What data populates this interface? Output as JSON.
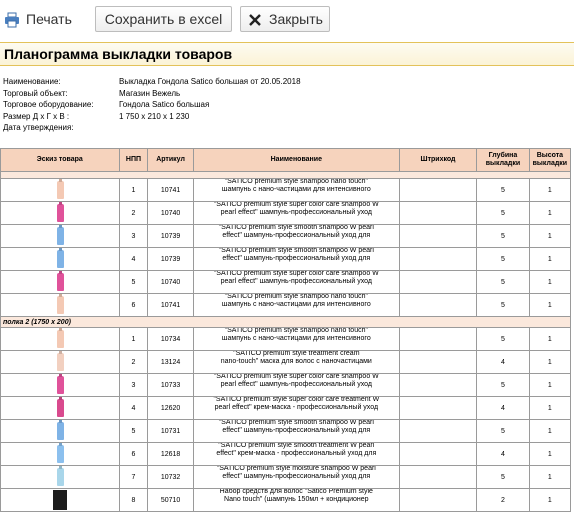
{
  "toolbar": {
    "print_label": "Печать",
    "excel_label": "Сохранить в excel",
    "close_label": "Закрыть"
  },
  "title": "Планограмма выкладки товаров",
  "meta": [
    {
      "label": "Наименование:",
      "value": "Выкладка Гондола Satico большая от 20.05.2018"
    },
    {
      "label": "Торговый объект:",
      "value": "Магазин Вежель"
    },
    {
      "label": "Торговое оборудование:",
      "value": "Гондола Satico большая"
    },
    {
      "label": "Размер Д х Г х В :",
      "value": "1 750 х 210 х 1 230"
    },
    {
      "label": "Дата утверждения:",
      "value": ""
    }
  ],
  "table": {
    "headers": [
      "Эскиз товара",
      "НПП",
      "Артикул",
      "Наименование",
      "Штрихкод",
      "Глубина выкладки",
      "Высота выкладки"
    ],
    "shelf2_label": "полка 2 (1750 х 200)",
    "shelf1_rows": [
      {
        "npp": "1",
        "art": "10741",
        "name1": "\"SATICO premium style shampoo nano touch\"",
        "name2": "шампунь с нано-частицами для интенсивного",
        "depth": "5",
        "height": "1",
        "color": "#f4c9b4"
      },
      {
        "npp": "2",
        "art": "10740",
        "name1": "\"SATICO premium style super color care shampoo W",
        "name2": "pearl effect\" шампунь-профессиональный уход",
        "depth": "5",
        "height": "1",
        "color": "#e0529a"
      },
      {
        "npp": "3",
        "art": "10739",
        "name1": "\"SATICO premium style smooth shampoo W pearl",
        "name2": "effect\" шампунь-профессиональный уход для",
        "depth": "5",
        "height": "1",
        "color": "#7fb3e6"
      },
      {
        "npp": "4",
        "art": "10739",
        "name1": "\"SATICO premium style smooth shampoo W pearl",
        "name2": "effect\" шампунь-профессиональный уход для",
        "depth": "5",
        "height": "1",
        "color": "#7fb3e6"
      },
      {
        "npp": "5",
        "art": "10740",
        "name1": "\"SATICO premium style super color care shampoo W",
        "name2": "pearl effect\" шампунь-профессиональный уход",
        "depth": "5",
        "height": "1",
        "color": "#e0529a"
      },
      {
        "npp": "6",
        "art": "10741",
        "name1": "\"SATICO premium style shampoo nano touch\"",
        "name2": "шампунь с нано-частицами для интенсивного",
        "depth": "5",
        "height": "1",
        "color": "#f4c9b4"
      }
    ],
    "shelf2_rows": [
      {
        "npp": "1",
        "art": "10734",
        "name1": "\"SATICO premium style shampoo nano touch\"",
        "name2": "шампунь с нано-частицами для интенсивного",
        "depth": "5",
        "height": "1",
        "color": "#f4c9b4"
      },
      {
        "npp": "2",
        "art": "13124",
        "name1": "\"SATICO premium style treatment cream",
        "name2": "nano-touch\" маска для волос с наночастицами",
        "depth": "4",
        "height": "1",
        "color": "#f2d0c0"
      },
      {
        "npp": "3",
        "art": "10733",
        "name1": "\"SATICO premium style super color care shampoo W",
        "name2": "pearl effect\" шампунь-профессиональный уход",
        "depth": "5",
        "height": "1",
        "color": "#e0529a"
      },
      {
        "npp": "4",
        "art": "12620",
        "name1": "\"SATICO premium style super color care treatment W",
        "name2": "pearl effect\" крем-маска - профессиональный уход",
        "depth": "4",
        "height": "1",
        "color": "#d94a8e"
      },
      {
        "npp": "5",
        "art": "10731",
        "name1": "\"SATICO premium style smooth shampoo W pearl",
        "name2": "effect\" шампунь-профессиональный уход для",
        "depth": "5",
        "height": "1",
        "color": "#7fb3e6"
      },
      {
        "npp": "6",
        "art": "12618",
        "name1": "\"SATICO premium style smooth treatment W pearl",
        "name2": "effect\" крем-маска - профессиональный уход для",
        "depth": "4",
        "height": "1",
        "color": "#8cc0ee"
      },
      {
        "npp": "7",
        "art": "10732",
        "name1": "\"SATICO premium style moisture shampoo W pearl",
        "name2": "effect\" шампунь-профессиональный уход для",
        "depth": "5",
        "height": "1",
        "color": "#a9d6ea"
      },
      {
        "npp": "8",
        "art": "50710",
        "name1": "Набор средств для волос \"Satico Premium style",
        "name2": "Nano touch\" (шампунь 150мл + кондиционер",
        "depth": "2",
        "height": "1",
        "color": "#1c1c1c"
      }
    ]
  }
}
